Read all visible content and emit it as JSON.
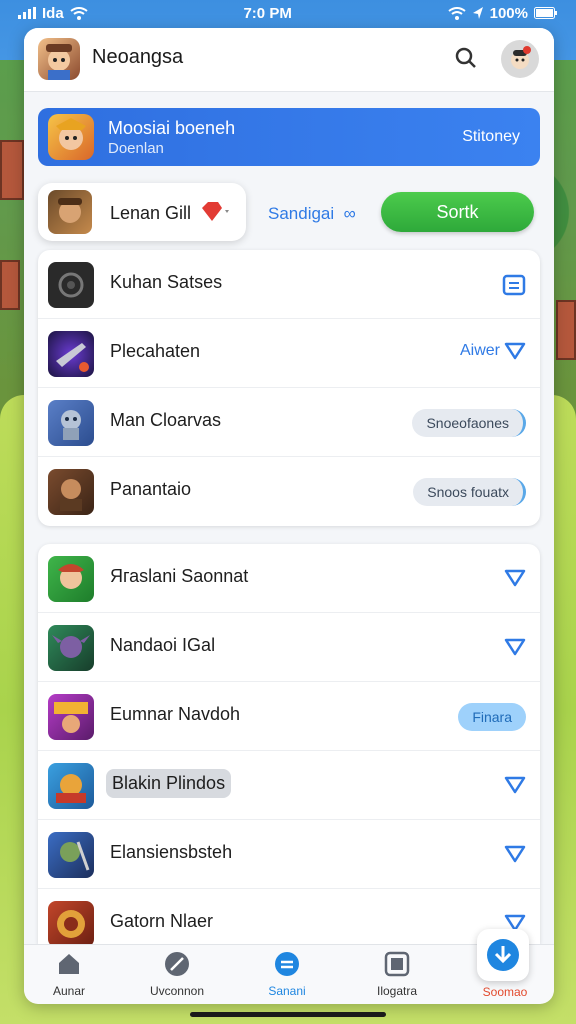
{
  "status_bar": {
    "carrier": "Ida",
    "time": "7:0 PM",
    "battery": "100%"
  },
  "header": {
    "title": "Neoangsa"
  },
  "banner": {
    "title": "Moosiai boeneh",
    "subtitle": "Doenlan",
    "right_label": "Stitoney"
  },
  "profile_chip": {
    "label": "Lenan Gill"
  },
  "controls": {
    "link_label": "Sandigai",
    "button_label": "Sortk"
  },
  "list1": [
    {
      "label": "Kuhan Satses",
      "action": "edit-icon"
    },
    {
      "label": "Plecahaten",
      "action_label": "Aiwer"
    },
    {
      "label": "Man Cloarvas",
      "pill": "Snoeofaones"
    },
    {
      "label": "Panantaio",
      "pill": "Snoos fouatx"
    }
  ],
  "list2": [
    {
      "label": "Ягаslani Saonnat"
    },
    {
      "label": "Nandaoi IGal"
    },
    {
      "label": "Eumnar Navdoh",
      "pill": "Finara"
    },
    {
      "label": "Blakin Plindos"
    },
    {
      "label": "Elansiensbsteh"
    },
    {
      "label": "Gatorn Nlaer"
    }
  ],
  "bottom_nav": [
    {
      "label": "Aunar",
      "icon": "home-icon"
    },
    {
      "label": "Uvconnon",
      "icon": "compass-icon"
    },
    {
      "label": "Sanani",
      "icon": "menu-circle-icon"
    },
    {
      "label": "Ilogatra",
      "icon": "library-icon"
    },
    {
      "label": "Soomao",
      "icon": "download-icon"
    }
  ],
  "colors": {
    "accent": "#2f7ae5",
    "green_button": "#3cb843",
    "nav_active": "#1f86e0",
    "nav_highlight": "#e24a2d"
  }
}
